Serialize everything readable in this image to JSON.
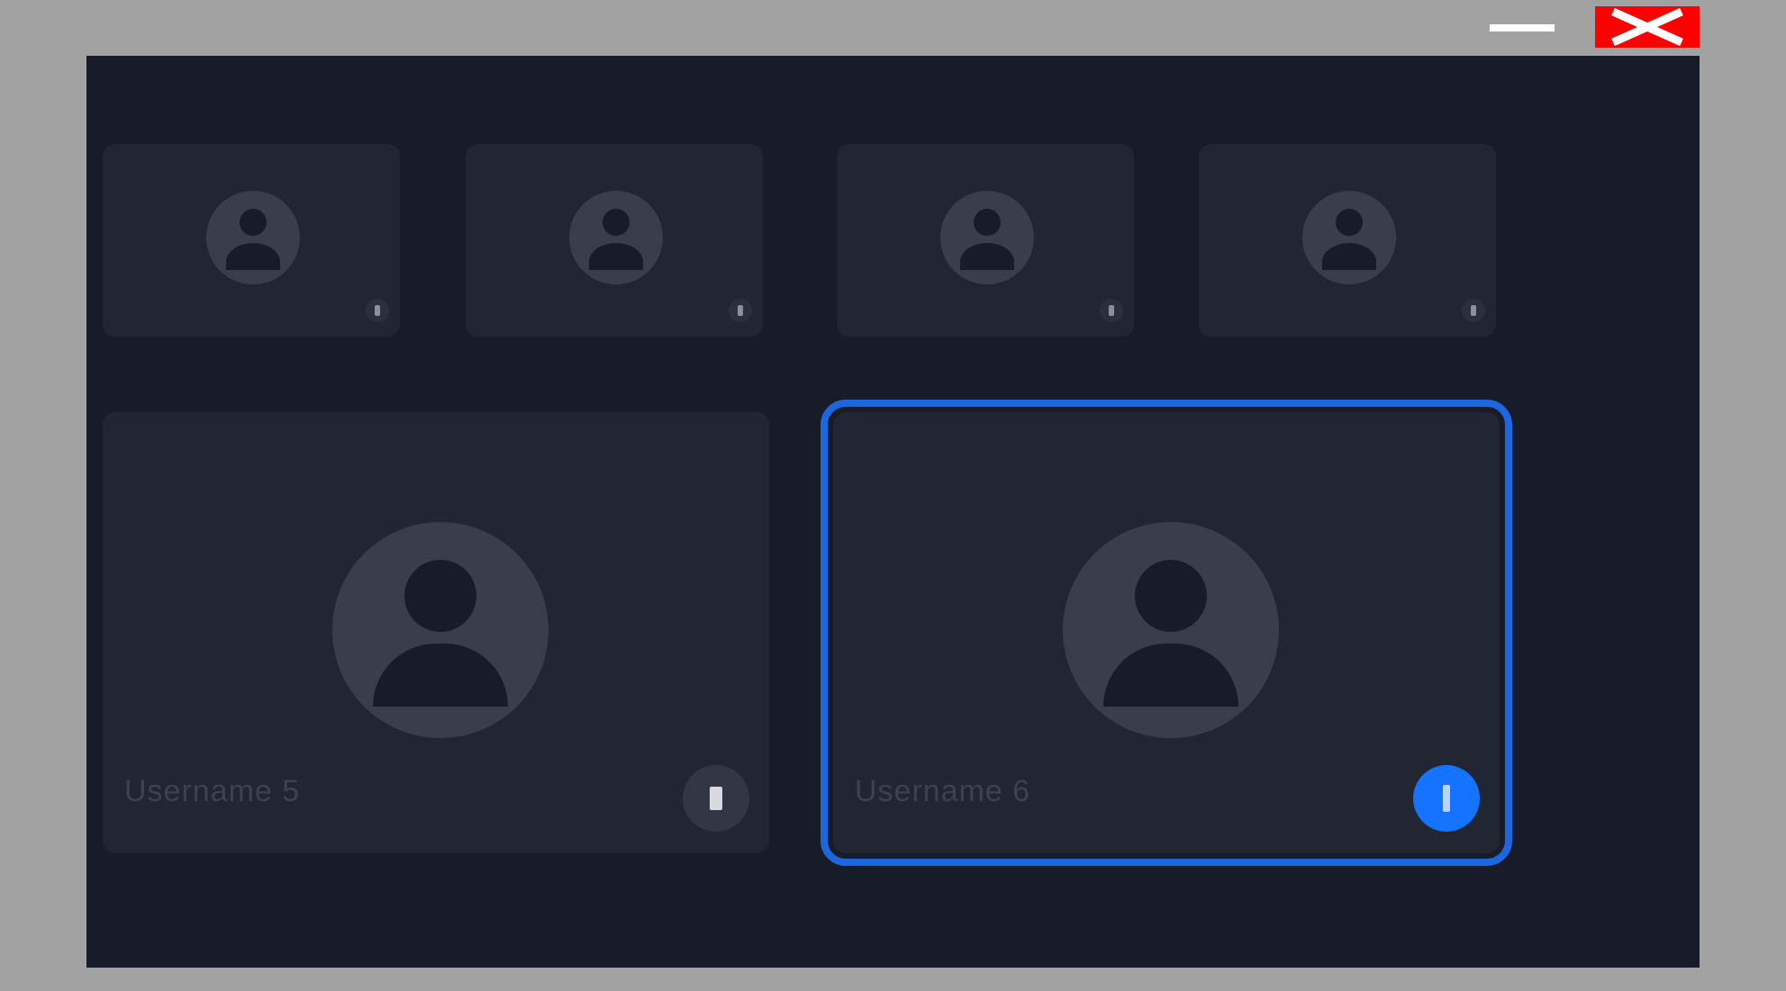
{
  "window_controls": {
    "minimize_icon": "minimize-icon",
    "close_icon": "close-icon",
    "close_color": "#ff0000"
  },
  "participants": {
    "small": [
      {
        "name": "",
        "mic_icon": "microphone-icon"
      },
      {
        "name": "",
        "mic_icon": "microphone-off-icon"
      },
      {
        "name": "",
        "mic_icon": "microphone-icon"
      },
      {
        "name": "",
        "mic_icon": "microphone-icon"
      }
    ],
    "large": [
      {
        "name": "Username 5",
        "mic_icon": "microphone-icon",
        "active": false
      },
      {
        "name": "Username 6",
        "mic_icon": "microphone-icon",
        "active": true,
        "active_color": "#1473ff"
      }
    ]
  },
  "colors": {
    "background": "#181c29",
    "tile": "#222633",
    "highlight_border": "#1c66e0"
  }
}
